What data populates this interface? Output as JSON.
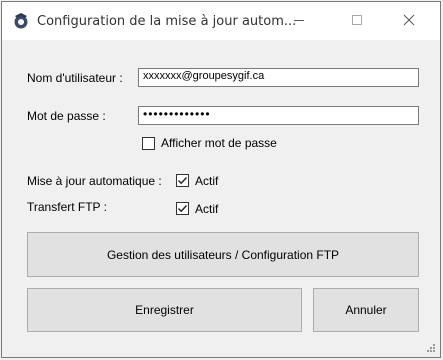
{
  "window": {
    "title": "Configuration de la mise à jour autom..."
  },
  "form": {
    "username_label": "Nom d'utilisateur :",
    "username_value": "xxxxxxx@groupesygif.ca",
    "password_label": "Mot de passe :",
    "password_value": "•••••••••••••",
    "show_password_label": "Afficher mot de passe",
    "show_password_checked": false,
    "auto_update_label": "Mise à jour automatique :",
    "auto_update_option": "Actif",
    "auto_update_checked": true,
    "ftp_label": "Transfert FTP :",
    "ftp_option": "Actif",
    "ftp_checked": true
  },
  "buttons": {
    "manage": "Gestion des utilisateurs / Configuration FTP",
    "save": "Enregistrer",
    "cancel": "Annuler"
  }
}
